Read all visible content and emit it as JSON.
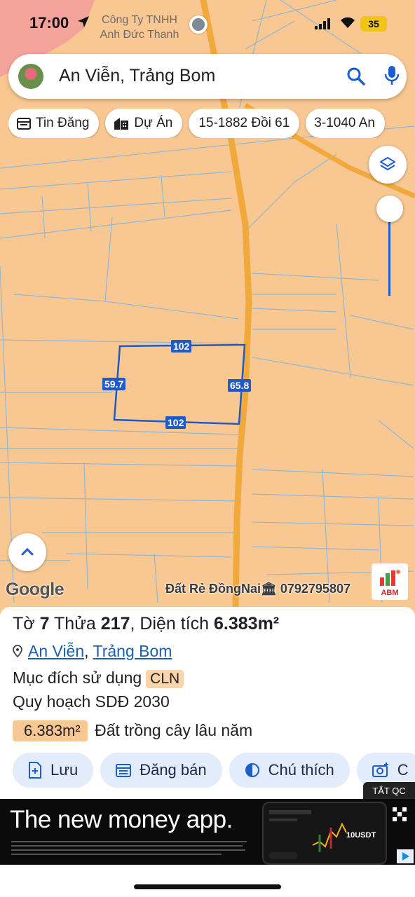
{
  "status_bar": {
    "time": "17:00",
    "poi_label": "Công Ty TNHH Anh Đức Thanh",
    "battery": "35"
  },
  "search": {
    "query": "An Viễn, Trảng Bom"
  },
  "chips": [
    {
      "label": "Tin Đăng",
      "icon": "calendar-icon"
    },
    {
      "label": "Dự Án",
      "icon": "building-icon"
    },
    {
      "label": "15-1882 Đồi 61",
      "icon": ""
    },
    {
      "label": "3-1040 An",
      "icon": ""
    }
  ],
  "parcel": {
    "top_edge": "102",
    "bottom_edge": "102",
    "left_edge": "59.7",
    "right_edge": "65.8"
  },
  "map_footer": {
    "google": "Google",
    "watermark": "Đất Rẻ ĐồngNai🏛 0792795807",
    "logo_text": "ABM"
  },
  "info": {
    "title_prefix": "Tờ ",
    "sheet_no": "7",
    "title_mid": " Thửa ",
    "parcel_no": "217",
    "title_area_label": ", Diện tích ",
    "area": "6.383m²",
    "loc_commune": "An Viễn",
    "loc_sep": ", ",
    "loc_district": "Trảng Bom",
    "purpose_label": "Mục đích sử dụng",
    "purpose_code": "CLN",
    "plan_label": "Quy hoạch SDĐ 2030",
    "plan_area": "6.383m²",
    "plan_desc": "Đất trồng cây lâu năm"
  },
  "actions": [
    {
      "label": "Lưu",
      "icon": "save-file-icon"
    },
    {
      "label": "Đăng bán",
      "icon": "calendar-list-icon"
    },
    {
      "label": "Chú thích",
      "icon": "half-circle-icon"
    },
    {
      "label": "C",
      "icon": "camera-add-icon"
    }
  ],
  "ad": {
    "close_label": "TẮT QC",
    "headline": "The new money app.",
    "usdt": "10USDT"
  },
  "colors": {
    "map_bg": "#f9c892",
    "road": "#f2a93b",
    "parcel_line": "#1e5bc6",
    "accent": "#1a5fd0"
  }
}
